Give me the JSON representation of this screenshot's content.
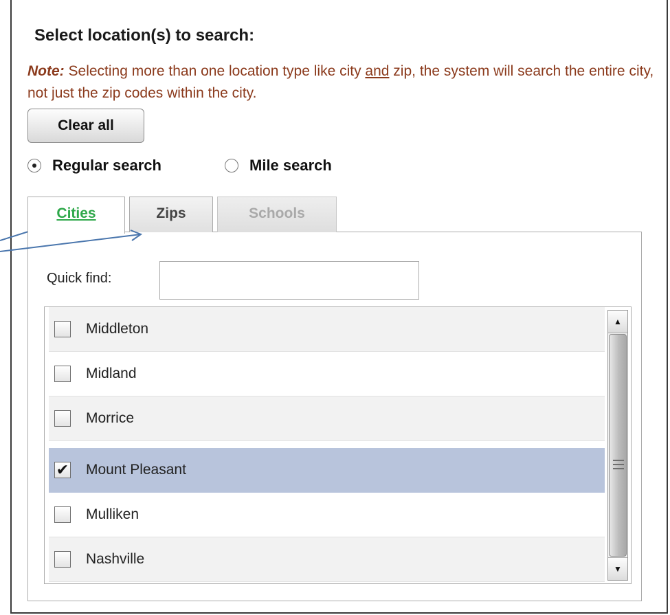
{
  "heading": "Select location(s) to search:",
  "note": {
    "label": "Note:",
    "text_before": " Selecting more than one location type like city ",
    "underlined": "and",
    "text_after": " zip, the system will search the entire city, not just the zip codes within the city."
  },
  "clear_all_label": "Clear all",
  "search_modes": {
    "regular_label": "Regular search",
    "mile_label": "Mile search",
    "selected": "Regular search"
  },
  "tabs": [
    {
      "label": "Cities",
      "state": "active"
    },
    {
      "label": "Zips",
      "state": "inactive"
    },
    {
      "label": "Schools",
      "state": "disabled"
    }
  ],
  "quick_find": {
    "label": "Quick find:",
    "value": ""
  },
  "cities": [
    {
      "label": "Middleton",
      "checked": false
    },
    {
      "label": "Midland",
      "checked": false
    },
    {
      "label": "Morrice",
      "checked": false
    },
    {
      "label": "Mount Pleasant",
      "checked": true
    },
    {
      "label": "Mulliken",
      "checked": false
    },
    {
      "label": "Nashville",
      "checked": false
    }
  ],
  "colors": {
    "note_text": "#8b3a1c",
    "active_tab": "#2ea84a",
    "selected_row": "#b8c4dc",
    "annotation_arrow": "#4a76ad"
  },
  "icons": {
    "checkbox_checked": "checkmark-icon",
    "scroll_up": "triangle-up-icon",
    "scroll_down": "triangle-down-icon"
  }
}
